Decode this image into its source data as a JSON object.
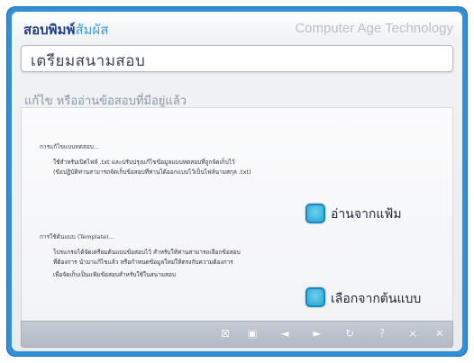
{
  "header": {
    "app_title_main": "สอบพิมพ์",
    "app_title_accent": "สัมผัส",
    "company": "Computer Age Technology"
  },
  "page": {
    "title": "เตรียมสนามสอบ",
    "section_heading": "แก้ไข หรืออ่านข้อสอบที่มีอยู่แล้ว"
  },
  "option_file": {
    "heading": "การแก้ไขแบบทดสอบ...",
    "line1": "ใช้สำหรับเปิดไฟล์ .txt และปรับปรุงแก้ไขข้อมูลแบบทดสอบที่ถูกจัดเก็บไว้",
    "line2": "(ข้อปฏิบัติท่านสามารถจัดเก็บข้อสอบที่ท่านได้ออกแบบไว้เป็นไฟล์นามสกุล .txt)",
    "button_label": "อ่านจากแฟ้ม"
  },
  "option_template": {
    "heading": "การใช้ต้นแบบ (Template)...",
    "line1": "โปรแกรมได้จัดเตรียมต้นแบบข้อสอบไว้ สำหรับให้ท่านสามารถเลือกข้อสอบ",
    "line2": "ที่ต้องการ นำมาแก้ไขแล้ว หรือกำหนดข้อมูลใหม่ให้ตรงกับความต้องการ",
    "line3": "เพื่อจัดเก็บเป็นแฟ้มข้อสอบสำหรับใช้ในสนามสอบ",
    "button_label": "เลือกจากต้นแบบ"
  },
  "toolbar": {
    "icons": [
      "close-box-icon",
      "save-icon",
      "prev-icon",
      "next-icon",
      "refresh-icon",
      "help-icon",
      "minimize-icon",
      "exit-icon"
    ],
    "glyphs": [
      "⊠",
      "▣",
      "◄",
      "►",
      "↻",
      "?",
      "⨯",
      "✕"
    ]
  },
  "colors": {
    "frame_blue": "#2f8fd8",
    "title_navy": "#1f3f86",
    "accent_blue": "#3a9ee6",
    "button_cyan": "#26a6d6"
  }
}
